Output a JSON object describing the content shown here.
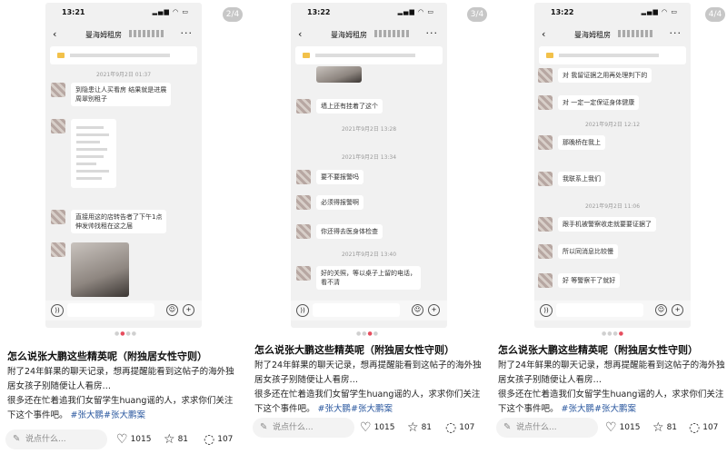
{
  "posts": [
    {
      "page_indicator": "2/4",
      "status_time": "13:21",
      "chat_title": "曼海姆租房",
      "messages": [
        {
          "type": "time",
          "text": "2021年9月2日 01:37"
        },
        {
          "type": "text",
          "text": "到隐患让人买看房 结果就是进展\n周翠别租子"
        },
        {
          "type": "image"
        },
        {
          "type": "text",
          "text": "直接用这的店转告者了下午1点\n伸发帅找租在这之届"
        },
        {
          "type": "photo"
        }
      ],
      "title": "怎么说张大鹏这些精英呢（附独居女性守则）",
      "body": "附了24年鲜果的聊天记录，想再提醒能看到这帖子的海外独居女孩子别随便让人看房…",
      "body2": "很多还在忙着追我们女留学生huang谣的人，求求你们关注下这个事件吧。",
      "tags": "#张大鹏#张大鹏案",
      "comment_placeholder": "说点什么...",
      "likes": "1015",
      "favorites": "81",
      "comments": "107"
    },
    {
      "page_indicator": "3/4",
      "status_time": "13:22",
      "chat_title": "曼海姆租房",
      "messages": [
        {
          "type": "photo-small"
        },
        {
          "type": "text",
          "text": "墙上还有挂着了这个"
        },
        {
          "type": "time",
          "text": "2021年9月2日 13:28"
        },
        {
          "type": "time",
          "text": "2021年9月2日 13:34"
        },
        {
          "type": "text",
          "text": "要不要报警吗"
        },
        {
          "type": "text",
          "text": "必须得报警啊"
        },
        {
          "type": "text",
          "text": "你还得去医身体检查"
        },
        {
          "type": "time",
          "text": "2021年9月2日 13:40"
        },
        {
          "type": "text",
          "text": "好的关照，等以桌子上留的电话，\n看不清"
        }
      ],
      "title": "怎么说张大鹏这些精英呢（附独居女性守则）",
      "body": "附了24年鲜果的聊天记录，想再提醒能看到这帖子的海外独居女孩子别随便让人看房…",
      "body2": "很多还在忙着造我们女留学生huang谣的人，求求你们关注下这个事件吧。",
      "tags": "#张大鹏#张大鹏案",
      "comment_placeholder": "说点什么...",
      "likes": "1015",
      "favorites": "81",
      "comments": "107"
    },
    {
      "page_indicator": "4/4",
      "status_time": "13:22",
      "chat_title": "曼海姆租房",
      "messages": [
        {
          "type": "text",
          "text": "对 我留证据之用再处理判下的"
        },
        {
          "type": "text",
          "text": "对 一定一定保证身体健康"
        },
        {
          "type": "time",
          "text": "2021年9月2日 12:12"
        },
        {
          "type": "text",
          "text": "那晚桥在我上"
        },
        {
          "type": "text",
          "text": "我联系上我们"
        },
        {
          "type": "time",
          "text": "2021年9月2日 11:06"
        },
        {
          "type": "text",
          "text": "跟手机被警察收走就要要证据了"
        },
        {
          "type": "text",
          "text": "所以同消息比较慢"
        },
        {
          "type": "text",
          "text": "好 等警察干了就好"
        }
      ],
      "title": "怎么说张大鹏这些精英呢（附独居女性守则）",
      "body": "附了24年鲜果的聊天记录，想再提醒能看到这帖子的海外独居女孩子别随便让人看房…",
      "body2": "很多还在忙着造我们女留学生huang谣的人，求求你们关注下这个事件吧。",
      "tags": "#张大鹏#张大鹏案",
      "comment_placeholder": "说点什么...",
      "likes": "1015",
      "favorites": "81",
      "comments": "107"
    }
  ],
  "icons": {
    "like": "heart-outline",
    "favorite": "star-outline",
    "comment": "speech-bubble",
    "edit": "pencil"
  }
}
